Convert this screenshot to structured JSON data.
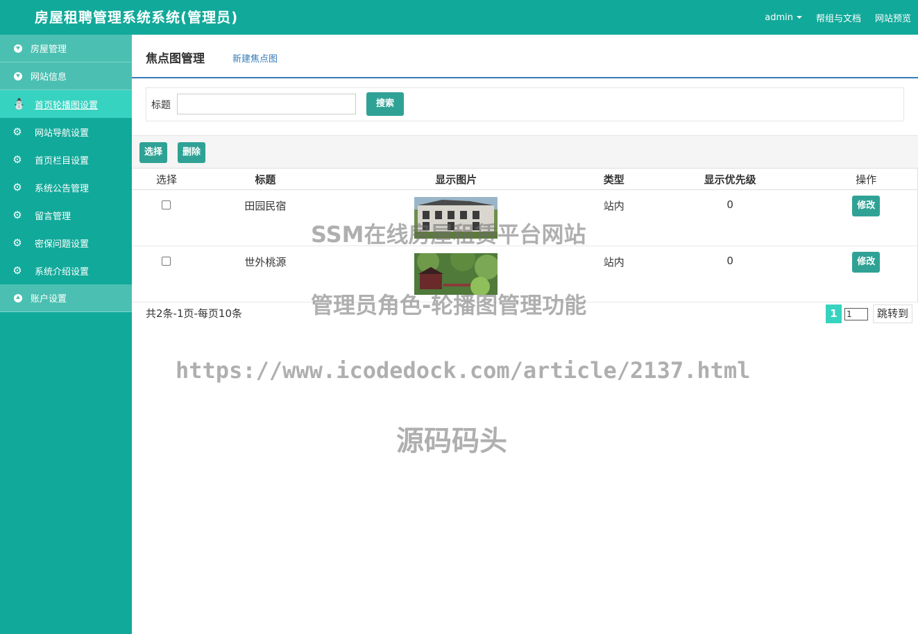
{
  "header": {
    "title": "房屋租聘管理系统系统(管理员)",
    "user": "admin",
    "help": "帮组与文档",
    "preview": "网站预览"
  },
  "sidebar": {
    "groups": [
      {
        "label": "房屋管理"
      },
      {
        "label": "网站信息"
      },
      {
        "label": "账户设置"
      }
    ],
    "items": [
      {
        "label": "首页轮播图设置",
        "icon": "database-icon"
      },
      {
        "label": "网站导航设置",
        "icon": "gear-icon"
      },
      {
        "label": "首页栏目设置",
        "icon": "gear-icon"
      },
      {
        "label": "系统公告管理",
        "icon": "gear-icon"
      },
      {
        "label": "留言管理",
        "icon": "gear-icon"
      },
      {
        "label": "密保问题设置",
        "icon": "gear-icon"
      },
      {
        "label": "系统介绍设置",
        "icon": "gear-icon"
      }
    ]
  },
  "page": {
    "title": "焦点图管理",
    "new_link": "新建焦点图"
  },
  "search": {
    "label": "标题",
    "value": "",
    "button": "搜索"
  },
  "toolbar": {
    "select": "选择",
    "delete": "删除"
  },
  "table": {
    "headers": [
      "选择",
      "标题",
      "显示图片",
      "类型",
      "显示优先级",
      "操作"
    ],
    "rows": [
      {
        "title": "田园民宿",
        "type": "站内",
        "priority": "0",
        "action": "修改"
      },
      {
        "title": "世外桃源",
        "type": "站内",
        "priority": "0",
        "action": "修改"
      }
    ]
  },
  "pagination": {
    "info": "共2条-1页-每页10条",
    "current": "1",
    "input": "1",
    "jump": "跳转到"
  },
  "watermarks": {
    "line1": "SSM在线房屋租赁平台网站",
    "line2": "管理员角色-轮播图管理功能",
    "line3": "https://www.icodedock.com/article/2137.html",
    "line4": "源码码头"
  },
  "colors": {
    "primary": "#11a99a",
    "active": "#37d3c1",
    "button": "#2fa295",
    "link": "#337ab7"
  }
}
